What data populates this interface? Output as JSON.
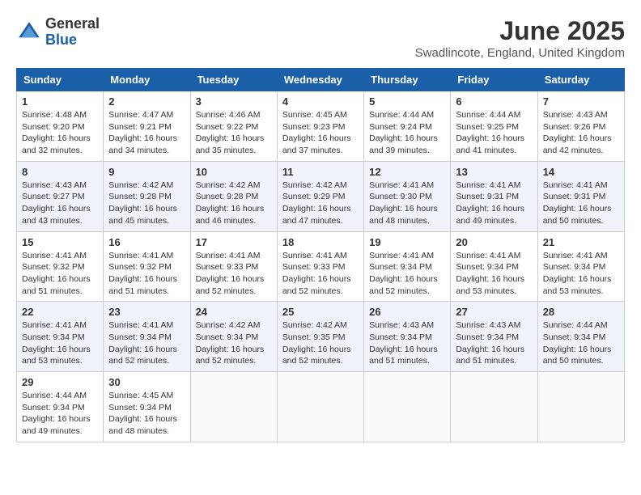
{
  "header": {
    "logo_general": "General",
    "logo_blue": "Blue",
    "title": "June 2025",
    "location": "Swadlincote, England, United Kingdom"
  },
  "weekdays": [
    "Sunday",
    "Monday",
    "Tuesday",
    "Wednesday",
    "Thursday",
    "Friday",
    "Saturday"
  ],
  "weeks": [
    [
      {
        "day": "1",
        "info": "Sunrise: 4:48 AM\nSunset: 9:20 PM\nDaylight: 16 hours\nand 32 minutes."
      },
      {
        "day": "2",
        "info": "Sunrise: 4:47 AM\nSunset: 9:21 PM\nDaylight: 16 hours\nand 34 minutes."
      },
      {
        "day": "3",
        "info": "Sunrise: 4:46 AM\nSunset: 9:22 PM\nDaylight: 16 hours\nand 35 minutes."
      },
      {
        "day": "4",
        "info": "Sunrise: 4:45 AM\nSunset: 9:23 PM\nDaylight: 16 hours\nand 37 minutes."
      },
      {
        "day": "5",
        "info": "Sunrise: 4:44 AM\nSunset: 9:24 PM\nDaylight: 16 hours\nand 39 minutes."
      },
      {
        "day": "6",
        "info": "Sunrise: 4:44 AM\nSunset: 9:25 PM\nDaylight: 16 hours\nand 41 minutes."
      },
      {
        "day": "7",
        "info": "Sunrise: 4:43 AM\nSunset: 9:26 PM\nDaylight: 16 hours\nand 42 minutes."
      }
    ],
    [
      {
        "day": "8",
        "info": "Sunrise: 4:43 AM\nSunset: 9:27 PM\nDaylight: 16 hours\nand 43 minutes."
      },
      {
        "day": "9",
        "info": "Sunrise: 4:42 AM\nSunset: 9:28 PM\nDaylight: 16 hours\nand 45 minutes."
      },
      {
        "day": "10",
        "info": "Sunrise: 4:42 AM\nSunset: 9:28 PM\nDaylight: 16 hours\nand 46 minutes."
      },
      {
        "day": "11",
        "info": "Sunrise: 4:42 AM\nSunset: 9:29 PM\nDaylight: 16 hours\nand 47 minutes."
      },
      {
        "day": "12",
        "info": "Sunrise: 4:41 AM\nSunset: 9:30 PM\nDaylight: 16 hours\nand 48 minutes."
      },
      {
        "day": "13",
        "info": "Sunrise: 4:41 AM\nSunset: 9:31 PM\nDaylight: 16 hours\nand 49 minutes."
      },
      {
        "day": "14",
        "info": "Sunrise: 4:41 AM\nSunset: 9:31 PM\nDaylight: 16 hours\nand 50 minutes."
      }
    ],
    [
      {
        "day": "15",
        "info": "Sunrise: 4:41 AM\nSunset: 9:32 PM\nDaylight: 16 hours\nand 51 minutes."
      },
      {
        "day": "16",
        "info": "Sunrise: 4:41 AM\nSunset: 9:32 PM\nDaylight: 16 hours\nand 51 minutes."
      },
      {
        "day": "17",
        "info": "Sunrise: 4:41 AM\nSunset: 9:33 PM\nDaylight: 16 hours\nand 52 minutes."
      },
      {
        "day": "18",
        "info": "Sunrise: 4:41 AM\nSunset: 9:33 PM\nDaylight: 16 hours\nand 52 minutes."
      },
      {
        "day": "19",
        "info": "Sunrise: 4:41 AM\nSunset: 9:34 PM\nDaylight: 16 hours\nand 52 minutes."
      },
      {
        "day": "20",
        "info": "Sunrise: 4:41 AM\nSunset: 9:34 PM\nDaylight: 16 hours\nand 53 minutes."
      },
      {
        "day": "21",
        "info": "Sunrise: 4:41 AM\nSunset: 9:34 PM\nDaylight: 16 hours\nand 53 minutes."
      }
    ],
    [
      {
        "day": "22",
        "info": "Sunrise: 4:41 AM\nSunset: 9:34 PM\nDaylight: 16 hours\nand 53 minutes."
      },
      {
        "day": "23",
        "info": "Sunrise: 4:41 AM\nSunset: 9:34 PM\nDaylight: 16 hours\nand 52 minutes."
      },
      {
        "day": "24",
        "info": "Sunrise: 4:42 AM\nSunset: 9:34 PM\nDaylight: 16 hours\nand 52 minutes."
      },
      {
        "day": "25",
        "info": "Sunrise: 4:42 AM\nSunset: 9:35 PM\nDaylight: 16 hours\nand 52 minutes."
      },
      {
        "day": "26",
        "info": "Sunrise: 4:43 AM\nSunset: 9:34 PM\nDaylight: 16 hours\nand 51 minutes."
      },
      {
        "day": "27",
        "info": "Sunrise: 4:43 AM\nSunset: 9:34 PM\nDaylight: 16 hours\nand 51 minutes."
      },
      {
        "day": "28",
        "info": "Sunrise: 4:44 AM\nSunset: 9:34 PM\nDaylight: 16 hours\nand 50 minutes."
      }
    ],
    [
      {
        "day": "29",
        "info": "Sunrise: 4:44 AM\nSunset: 9:34 PM\nDaylight: 16 hours\nand 49 minutes."
      },
      {
        "day": "30",
        "info": "Sunrise: 4:45 AM\nSunset: 9:34 PM\nDaylight: 16 hours\nand 48 minutes."
      },
      null,
      null,
      null,
      null,
      null
    ]
  ]
}
